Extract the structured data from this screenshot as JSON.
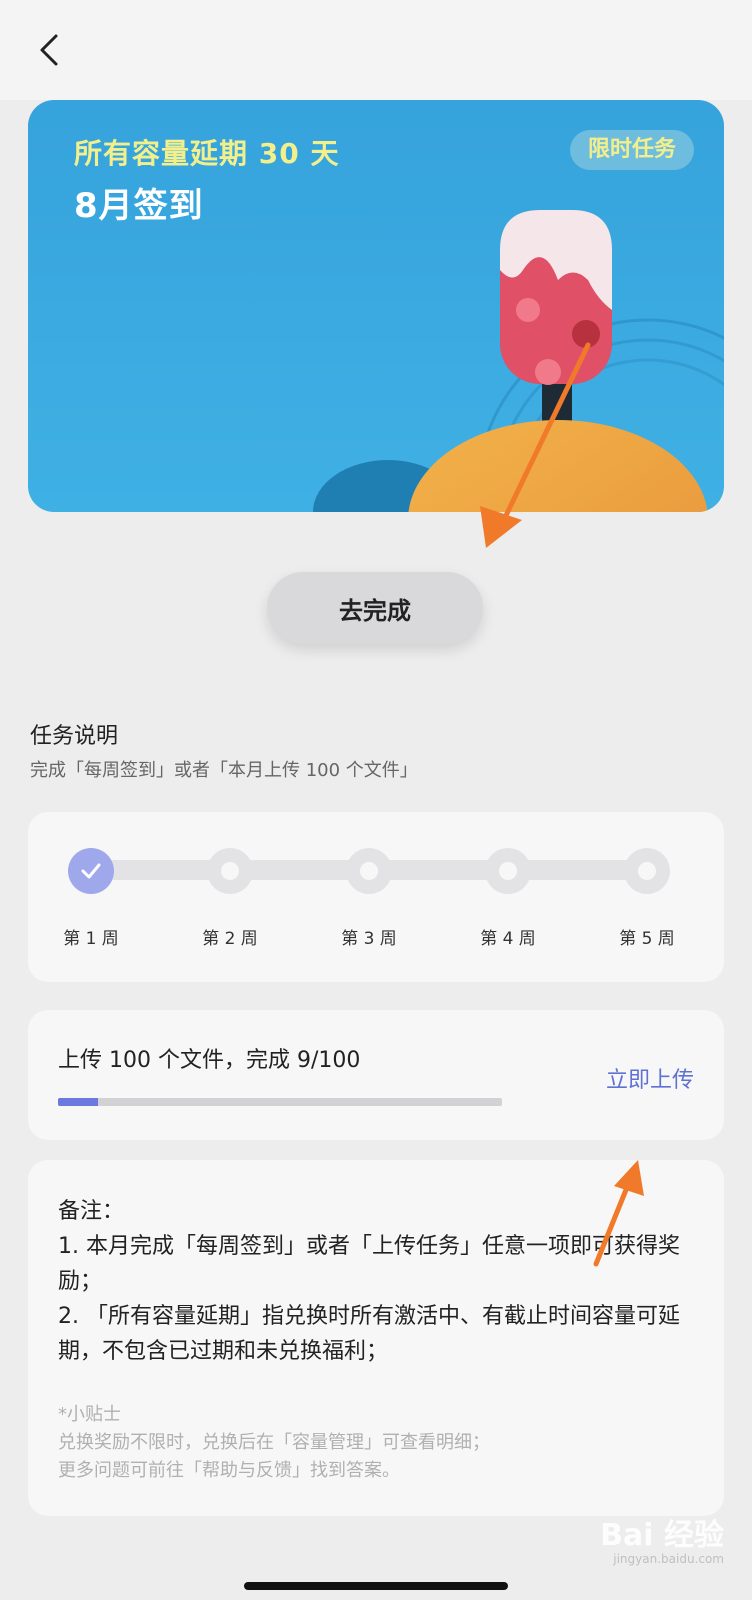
{
  "banner": {
    "subtitle": "所有容量延期 30 天",
    "title": "8月签到",
    "badge": "限时任务"
  },
  "action_button": "去完成",
  "task": {
    "title": "任务说明",
    "description": "完成「每周签到」或者「本月上传 100 个文件」"
  },
  "weeks": [
    {
      "label": "第 1 周",
      "done": true
    },
    {
      "label": "第 2 周",
      "done": false
    },
    {
      "label": "第 3 周",
      "done": false
    },
    {
      "label": "第 4 周",
      "done": false
    },
    {
      "label": "第 5 周",
      "done": false
    }
  ],
  "upload": {
    "text": "上传 100 个文件，完成 9/100",
    "progress": 0.09,
    "link": "立即上传"
  },
  "notes": {
    "heading": "备注：",
    "line1": "1. 本月完成「每周签到」或者「上传任务」任意一项即可获得奖励；",
    "line2": "2. 「所有容量延期」指兑换时所有激活中、有截止时间容量可延期，不包含已过期和未兑换福利；"
  },
  "tips": {
    "heading": "*小贴士",
    "line1": "兑换奖励不限时，兑换后在「容量管理」可查看明细；",
    "line2": "更多问题可前往「帮助与反馈」找到答案。"
  },
  "watermark": {
    "text": "Bai 经验",
    "sub": "jingyan.baidu.com"
  },
  "colors": {
    "accent": "#5f72d4",
    "progress": "#6b78e0",
    "banner_blue": "#3fa6de",
    "arrow": "#f07a2a"
  }
}
